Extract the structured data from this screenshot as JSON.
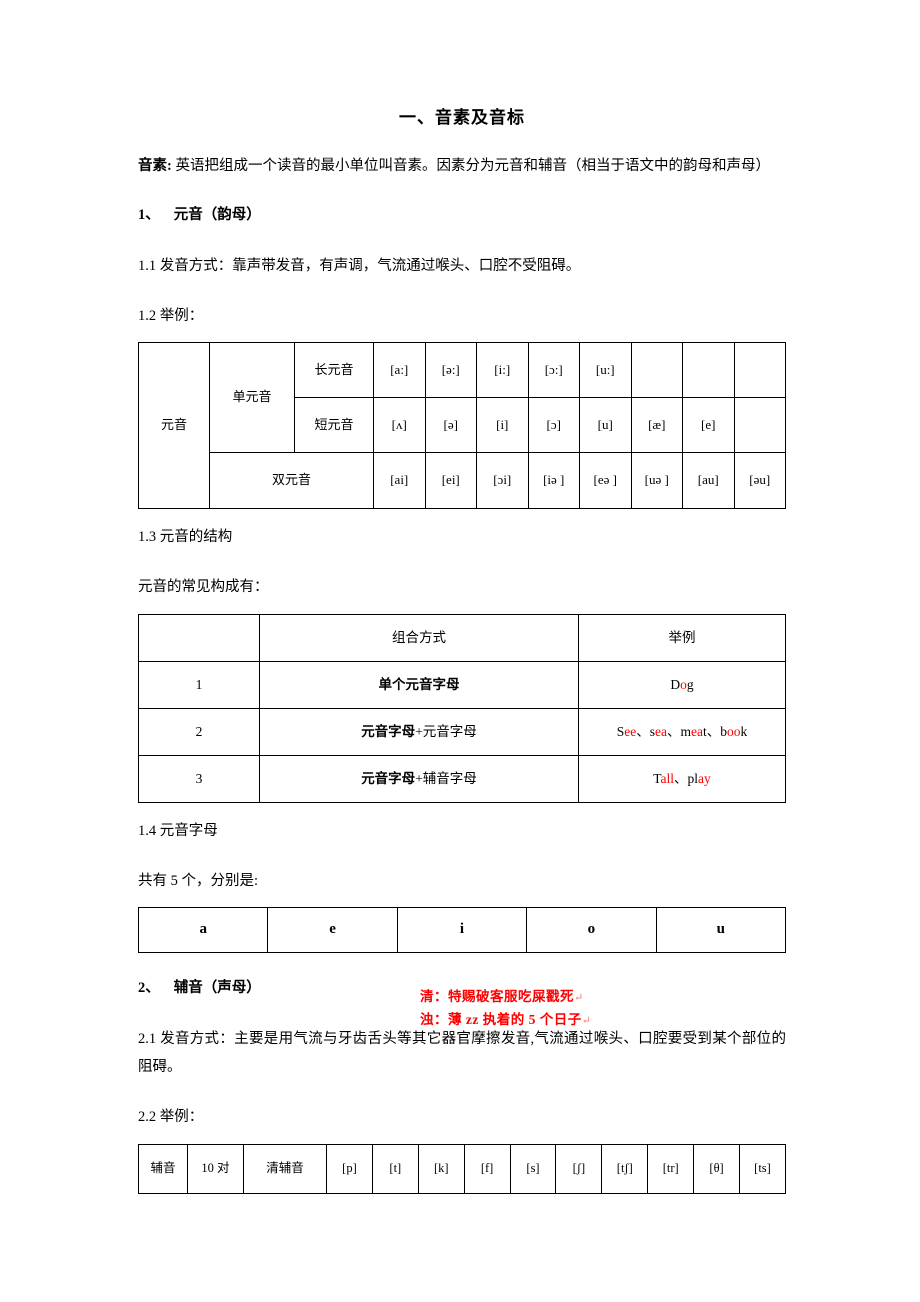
{
  "document": {
    "title": "一、音素及音标",
    "intro": {
      "label": "音素:",
      "text": " 英语把组成一个读音的最小单位叫音素。因素分为元音和辅音（相当于语文中的韵母和声母）"
    },
    "section1": {
      "heading_num": "1、",
      "heading_text": "元音（韵母）",
      "p_1_1": "1.1 发音方式：靠声带发音，有声调，气流通过喉头、口腔不受阻碍。",
      "p_1_2": "1.2 举例：",
      "p_1_3": "1.3 元音的结构",
      "p_1_3b": "元音的常见构成有：",
      "p_1_4": "1.4 元音字母",
      "p_1_4b": "共有 5 个，分别是:"
    },
    "section2": {
      "heading_num": "2、",
      "heading_text": "辅音（声母）",
      "p_2_1": "2.1 发音方式：主要是用气流与牙齿舌头等其它器官摩擦发音,气流通过喉头、口腔要受到某个部位的阻碍。",
      "p_2_2": "2.2 举例："
    },
    "annotation": {
      "line1": "清：特赐破客服吃屎戳死",
      "line1_mark": "↵",
      "line2": "浊：薄 zz 执着的 5 个日子",
      "line2_mark": "↵",
      "color": "#ff0000"
    }
  },
  "vowel_table": {
    "row_label": "元音",
    "mono_label": "单元音",
    "long_label": "长元音",
    "short_label": "短元音",
    "diph_label": "双元音",
    "long_vowels": [
      "[a:]",
      "[ə:]",
      "[i:]",
      "[ɔ:]",
      "[u:]",
      "",
      "",
      ""
    ],
    "short_vowels": [
      "[ʌ]",
      "[ə]",
      "[i]",
      "[ɔ]",
      "[u]",
      "[æ]",
      "[e]",
      ""
    ],
    "diphthongs": [
      "[ai]",
      "[ei]",
      "[ɔi]",
      "[iə ]",
      "[eə ]",
      "[uə ]",
      "[au]",
      "[əu]"
    ]
  },
  "structure_table": {
    "headers": [
      "",
      "组合方式",
      "举例"
    ],
    "rows": [
      {
        "index": "1",
        "combo_bold": "单个元音字母",
        "combo_plain": "",
        "example_parts": [
          {
            "t": "D",
            "red": false
          },
          {
            "t": "o",
            "red": true
          },
          {
            "t": "g",
            "red": false
          }
        ]
      },
      {
        "index": "2",
        "combo_bold": "元音字母",
        "combo_plain": "+元音字母",
        "example_parts": [
          {
            "t": "S",
            "red": false
          },
          {
            "t": "ee",
            "red": true
          },
          {
            "t": "、s",
            "red": false
          },
          {
            "t": "ea",
            "red": true
          },
          {
            "t": "、m",
            "red": false
          },
          {
            "t": "ea",
            "red": true
          },
          {
            "t": "t、b",
            "red": false
          },
          {
            "t": "oo",
            "red": true
          },
          {
            "t": "k",
            "red": false
          }
        ]
      },
      {
        "index": "3",
        "combo_bold": "元音字母",
        "combo_plain": "+辅音字母",
        "example_parts": [
          {
            "t": "T",
            "red": false
          },
          {
            "t": "all",
            "red": true
          },
          {
            "t": "、pl",
            "red": false
          },
          {
            "t": "ay",
            "red": true
          }
        ]
      }
    ]
  },
  "letters_table": {
    "letters": [
      "a",
      "e",
      "i",
      "o",
      "u"
    ]
  },
  "consonant_table": {
    "label": "辅音",
    "pairs": "10 对",
    "voiceless": "清辅音",
    "symbols": [
      "[p]",
      "[t]",
      "[k]",
      "[f]",
      "[s]",
      "[ʃ]",
      "[tʃ]",
      "[tr]",
      "[θ]",
      "[ts]"
    ]
  }
}
